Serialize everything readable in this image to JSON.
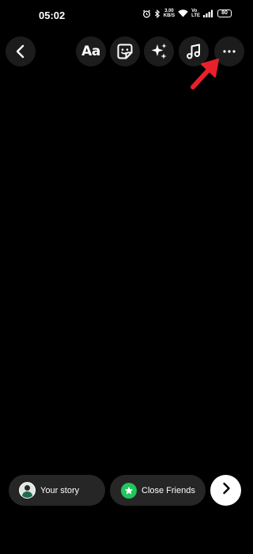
{
  "status_bar": {
    "time": "05:02",
    "net_speed_value": "3.00",
    "net_speed_unit": "KB/S",
    "volte_top": "Vo",
    "volte_bottom": "LTE",
    "battery": "80",
    "icons": [
      "alarm-icon",
      "bluetooth-icon",
      "wifi-icon",
      "signal-icon",
      "battery-icon"
    ]
  },
  "toolbar": {
    "back_icon": "chevron-left-icon",
    "text_label": "Aa",
    "buttons": [
      "text-button",
      "sticker-button",
      "effects-button",
      "music-button",
      "more-options-button"
    ]
  },
  "annotation": {
    "color": "#e8202a"
  },
  "bottom_bar": {
    "your_story_label": "Your story",
    "close_friends_label": "Close Friends",
    "close_friends_color": "#22c55e",
    "next_icon": "chevron-right-icon"
  }
}
